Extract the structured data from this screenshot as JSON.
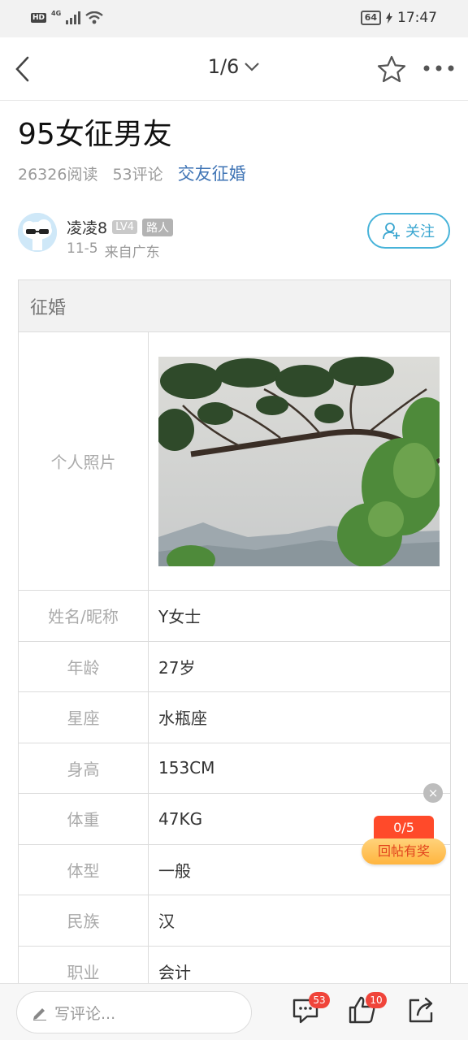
{
  "status_bar": {
    "time": "17:47",
    "battery": "64",
    "hd": "HD",
    "network": "4G"
  },
  "nav": {
    "page_indicator": "1/6"
  },
  "post": {
    "title": "95女征男友",
    "reads": "26326阅读",
    "comments": "53评论",
    "topic": "交友征婚"
  },
  "author": {
    "name": "凌凌8",
    "level": "LV4",
    "rank": "路人",
    "date": "11-5",
    "location": "来自广东",
    "follow_label": "关注"
  },
  "table": {
    "header": "征婚",
    "photo_label": "个人照片",
    "rows": [
      {
        "key": "姓名/昵称",
        "value": "Y女士"
      },
      {
        "key": "年龄",
        "value": "27岁"
      },
      {
        "key": "星座",
        "value": "水瓶座"
      },
      {
        "key": "身高",
        "value": "153CM"
      },
      {
        "key": "体重",
        "value": "47KG"
      },
      {
        "key": "体型",
        "value": "一般"
      },
      {
        "key": "民族",
        "value": "汉"
      },
      {
        "key": "职业",
        "value": "会计"
      }
    ]
  },
  "reward": {
    "count": "0/5",
    "label": "回帖有奖",
    "close": "×"
  },
  "bottom_bar": {
    "comment_placeholder": "写评论...",
    "comment_badge": "53",
    "like_badge": "10"
  },
  "colors": {
    "accent": "#47b3d9",
    "topic": "#3f74b5",
    "badge": "#f0443a"
  }
}
